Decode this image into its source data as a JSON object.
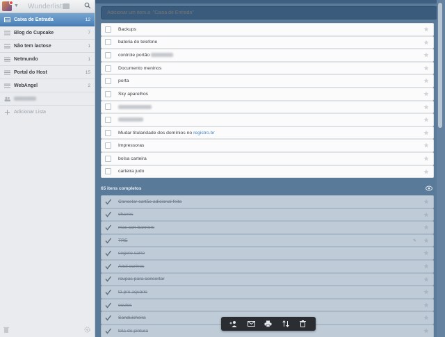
{
  "sidebar": {
    "app_title": "Wunderlist",
    "lists": [
      {
        "label": "Caixa de Entrada",
        "count": "12",
        "active": true
      },
      {
        "label": "Blog do Cupcake",
        "count": "7",
        "active": false
      },
      {
        "label": "Não tem lactose",
        "count": "1",
        "active": false
      },
      {
        "label": "Netmundo",
        "count": "1",
        "active": false
      },
      {
        "label": "Portal do Host",
        "count": "15",
        "active": false
      },
      {
        "label": "WebAngel",
        "count": "2",
        "active": false
      }
    ],
    "add_list_label": "Adicionar Lista"
  },
  "main": {
    "add_placeholder": "Adicionar um item a  \"Caixa de Entrada\"",
    "tasks": [
      {
        "label": "Backups"
      },
      {
        "label": "bateria do telefone"
      },
      {
        "label": "controle portão"
      },
      {
        "label": "Documento meninos"
      },
      {
        "label": "porta"
      },
      {
        "label": "Sky aparelhos"
      },
      {
        "label": ""
      },
      {
        "label": ""
      },
      {
        "label": "Mudar titularidade dos domínios no ",
        "link": "registro.br"
      },
      {
        "label": "Impressoras"
      },
      {
        "label": "bolsa carteira"
      },
      {
        "label": "carteira judo"
      }
    ],
    "completed_label": "65 itens completos",
    "completed_tasks": [
      {
        "label": "Cancelar cartão adicional feito"
      },
      {
        "label": "chaves"
      },
      {
        "label": "mas con banners"
      },
      {
        "label": "TRE"
      },
      {
        "label": "seguro carro"
      },
      {
        "label": "Anel ourives"
      },
      {
        "label": "roupas para consertar"
      },
      {
        "label": "tá pro aquário"
      },
      {
        "label": "oculos"
      },
      {
        "label": "Sanduicheira"
      },
      {
        "label": "tela de pintura"
      }
    ]
  },
  "colors": {
    "active_list": "#4b80b7",
    "main_bg": "#5a7a99",
    "link": "#3f80c4"
  }
}
